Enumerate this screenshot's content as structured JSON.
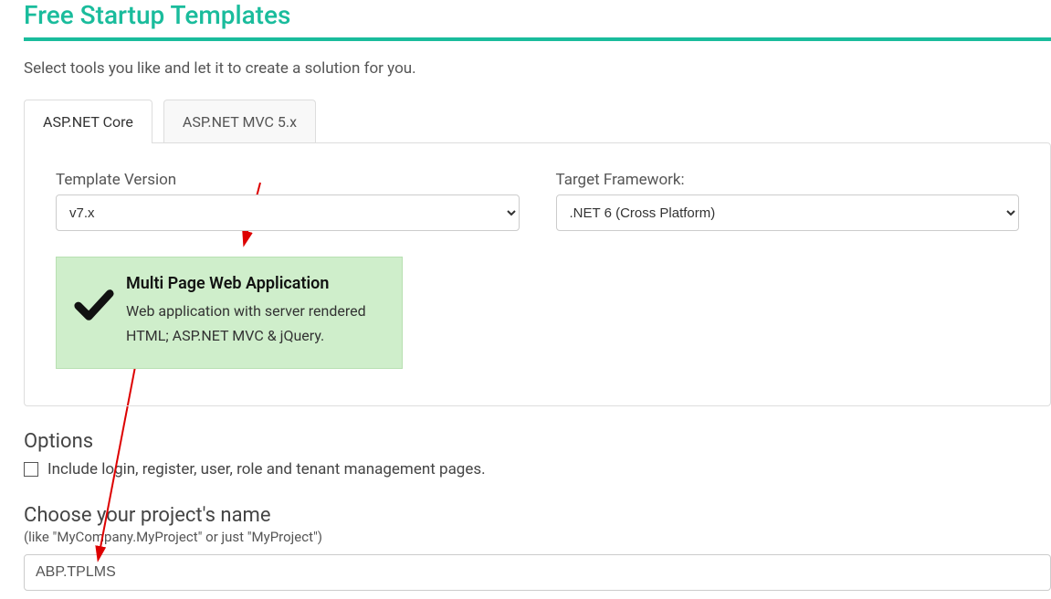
{
  "page": {
    "title": "Free Startup Templates",
    "subtitle": "Select tools you like and let it to create a solution for you."
  },
  "tabs": {
    "aspnet_core": "ASP.NET Core",
    "aspnet_mvc5": "ASP.NET MVC 5.x"
  },
  "form": {
    "template_version_label": "Template Version",
    "template_version_value": "v7.x",
    "target_framework_label": "Target Framework:",
    "target_framework_value": ".NET 6 (Cross Platform)"
  },
  "template_card": {
    "title": "Multi Page Web Application",
    "description": "Web application with server rendered HTML; ASP.NET MVC & jQuery."
  },
  "options": {
    "heading": "Options",
    "include_login_label": "Include login, register, user, role and tenant management pages."
  },
  "project_name": {
    "heading": "Choose your project's name",
    "hint": "(like \"MyCompany.MyProject\" or just \"MyProject\")",
    "value": "ABP.TPLMS"
  }
}
